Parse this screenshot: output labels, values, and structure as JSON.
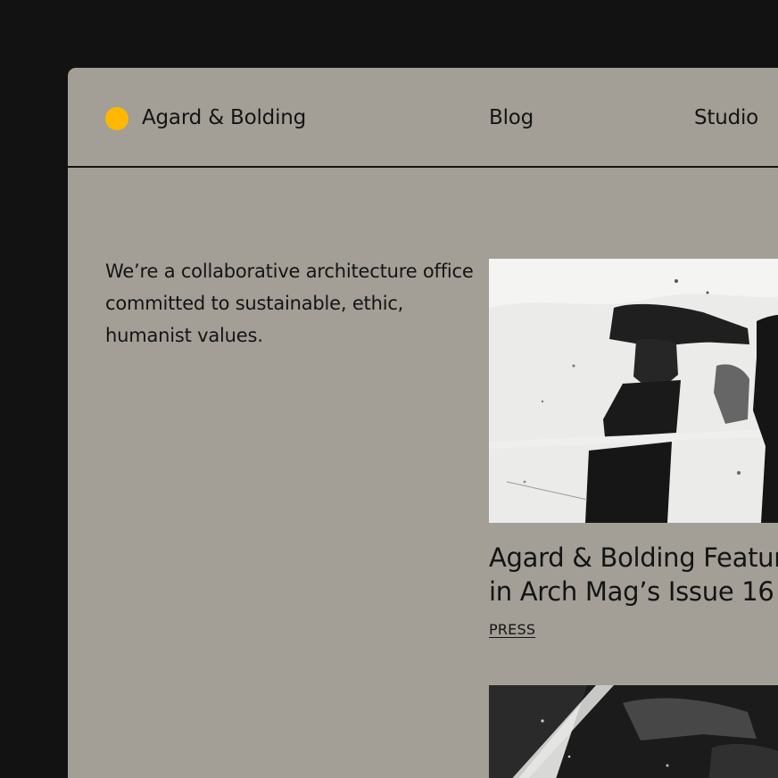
{
  "header": {
    "brand": "Agard & Bolding",
    "nav": [
      {
        "label": "Blog"
      },
      {
        "label": "Studio"
      }
    ]
  },
  "intro": {
    "text": "We’re a collaborative architecture office committed to sustainable, ethic, humanist values."
  },
  "posts": [
    {
      "title_line1": "Agard & Bolding Featur",
      "title_line2": "in Arch Mag’s Issue 16",
      "tag": "PRESS"
    }
  ],
  "colors": {
    "page_bg": "#121212",
    "panel_bg": "#a39f96",
    "accent": "#ffb800",
    "text": "#141414"
  }
}
